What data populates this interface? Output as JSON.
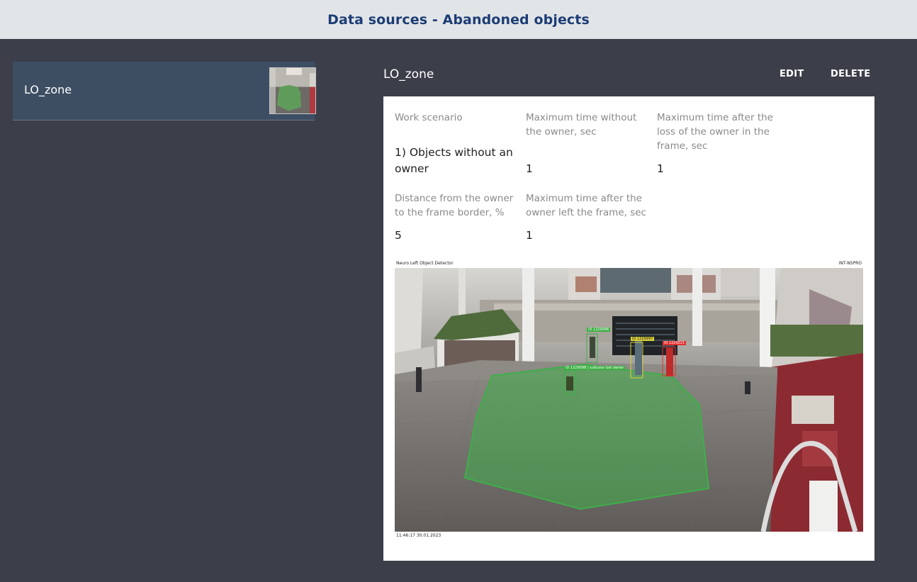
{
  "header": {
    "title": "Data sources - Abandoned objects"
  },
  "sources": [
    {
      "name": "LO_zone"
    }
  ],
  "detail": {
    "title": "LO_zone",
    "edit_label": "EDIT",
    "delete_label": "DELETE",
    "fields": {
      "work_scenario": {
        "label": "Work scenario",
        "value": "1) Objects without an owner"
      },
      "max_time_without_owner": {
        "label": "Maximum time without the owner, sec",
        "value": "1"
      },
      "max_time_after_loss": {
        "label": "Maximum time after the loss of the owner in the frame, sec",
        "value": "1"
      },
      "distance_to_border": {
        "label": "Distance from the owner to the frame border, %",
        "value": "5"
      },
      "max_time_owner_left": {
        "label": "Maximum time after the owner left the frame, sec",
        "value": "1"
      }
    },
    "camera": {
      "caption_left": "Neuro Left Object Detector",
      "caption_right": "INT-NSPRO",
      "timestamp": "11:46:17 30.01.2023",
      "zone_color": "#3fae4a",
      "detections": [
        {
          "label": "ID 1229996",
          "color": "#3cb043"
        },
        {
          "label": "ID 1229997",
          "color": "#d8d03a"
        },
        {
          "label": "ID 1229221",
          "color": "#e53030"
        },
        {
          "label": "ID 1229098 | suitcase lost owner",
          "color": "#3cb043"
        }
      ]
    }
  }
}
